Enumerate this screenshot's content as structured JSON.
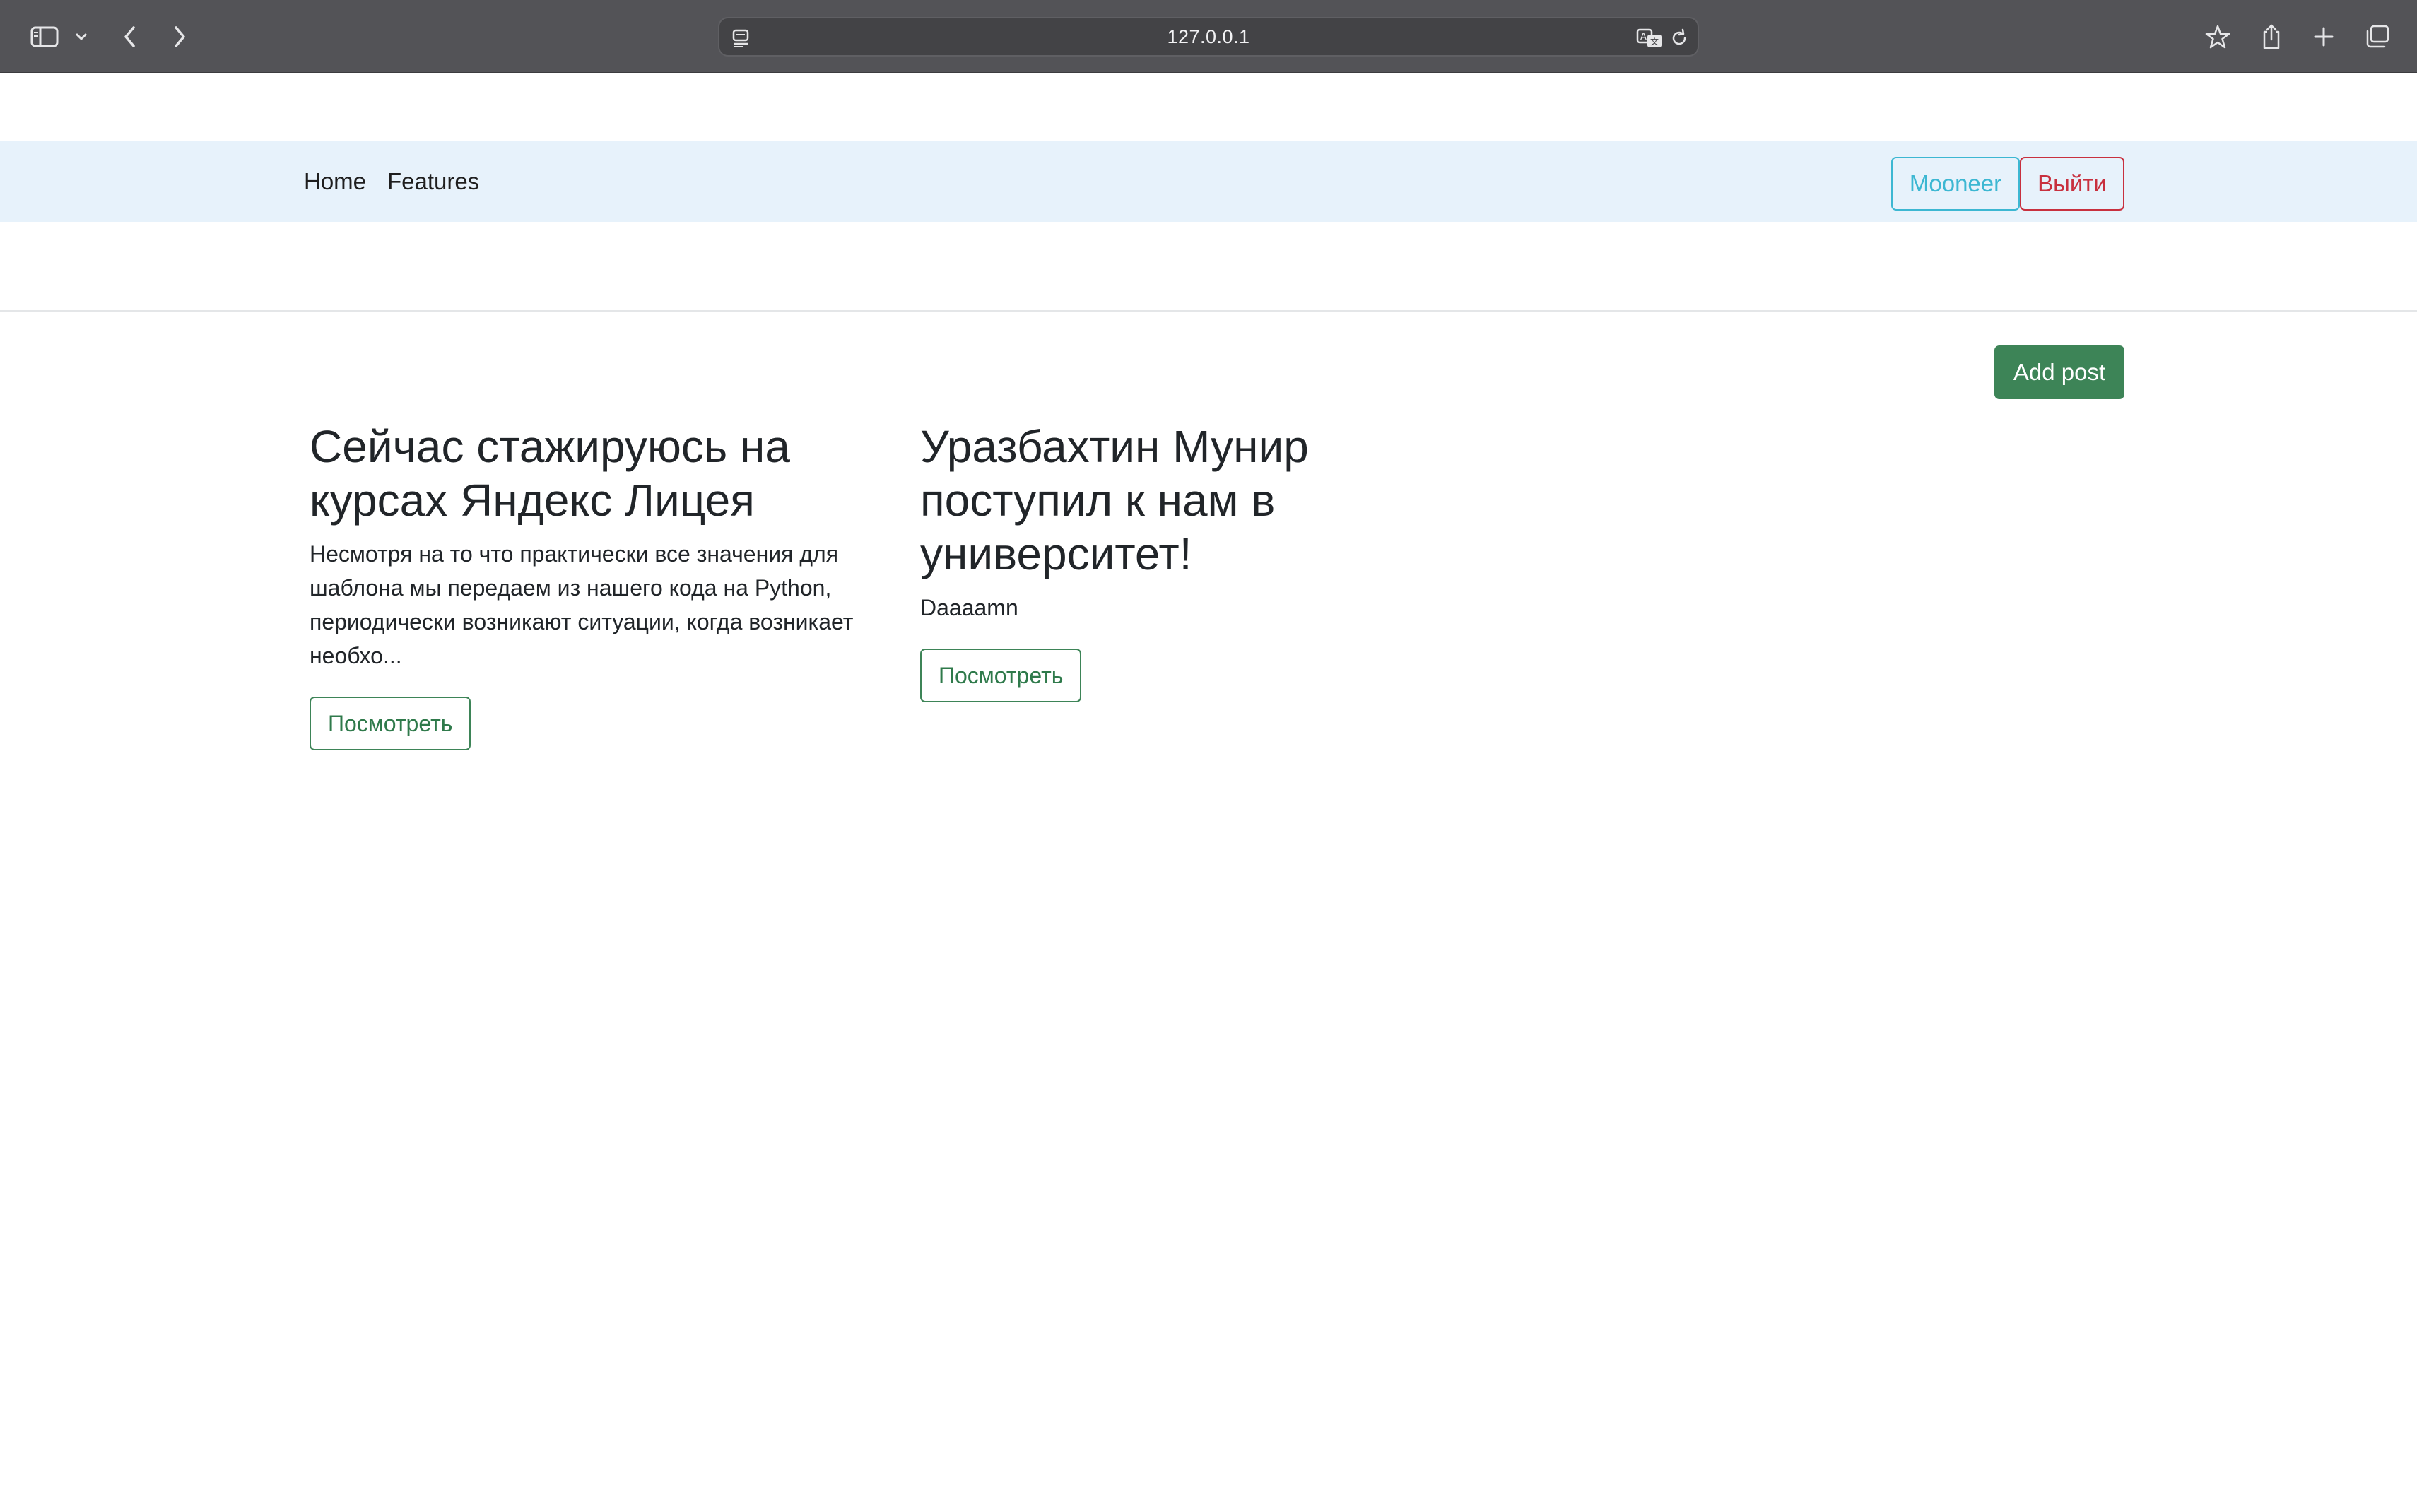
{
  "browser": {
    "url": "127.0.0.1"
  },
  "nav": {
    "links": [
      {
        "label": "Home"
      },
      {
        "label": "Features"
      }
    ],
    "user_button": "Mooneer",
    "logout_button": "Выйти"
  },
  "main": {
    "add_post_button": "Add post",
    "posts": [
      {
        "title": "Сейчас стажируюсь на курсах Яндекс Лицея",
        "excerpt": "Несмотря на то что практически все значения для шаблона мы передаем из нашего кода на Python, периодически возникают ситуации, когда возникает необхо...",
        "button": "Посмотреть"
      },
      {
        "title": "Уразбахтин Мунир поступил к нам в университет!",
        "excerpt": "Daaaamn",
        "button": "Посмотреть"
      }
    ]
  },
  "colors": {
    "navbar_bg": "#e7f2fb",
    "info": "#3cb7d2",
    "danger": "#c8303e",
    "success": "#3d8457"
  }
}
